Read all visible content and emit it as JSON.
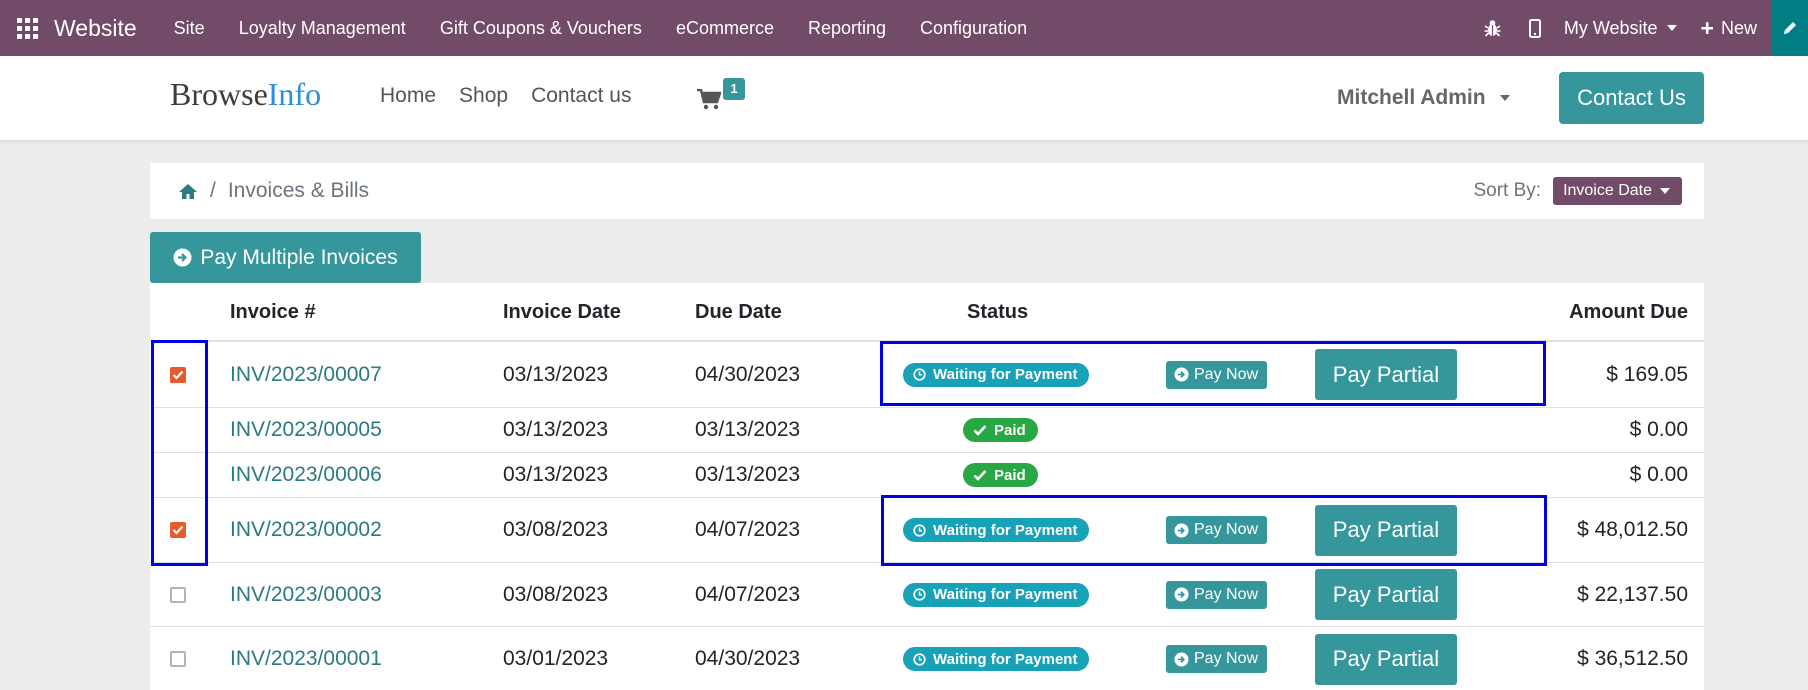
{
  "admin_bar": {
    "brand": "Website",
    "menu": [
      "Site",
      "Loyalty Management",
      "Gift Coupons & Vouchers",
      "eCommerce",
      "Reporting",
      "Configuration"
    ],
    "website_selector": "My Website",
    "new_label": "New",
    "icons": [
      "apps-icon",
      "bug-icon",
      "mobile-icon",
      "pencil-icon"
    ]
  },
  "header": {
    "logo_part1": "Browse",
    "logo_part2": "Info",
    "nav": [
      "Home",
      "Shop",
      "Contact us"
    ],
    "cart_count": "1",
    "user_name": "Mitchell Admin",
    "contact_button": "Contact Us"
  },
  "breadcrumb": {
    "separator": "/",
    "current": "Invoices & Bills"
  },
  "sort": {
    "label": "Sort By:",
    "value": "Invoice Date"
  },
  "pay_multiple_label": "Pay Multiple Invoices",
  "table": {
    "columns": [
      "Invoice #",
      "Invoice Date",
      "Due Date",
      "Status",
      "Amount Due"
    ],
    "rows": [
      {
        "number": "INV/2023/00007",
        "invoice_date": "03/13/2023",
        "due_date": "04/30/2023",
        "status": "Waiting for Payment",
        "pay_now": "Pay Now",
        "pay_partial": "Pay Partial",
        "amount": "$ 169.05",
        "checked": true
      },
      {
        "number": "INV/2023/00005",
        "invoice_date": "03/13/2023",
        "due_date": "03/13/2023",
        "status": "Paid",
        "amount": "$ 0.00"
      },
      {
        "number": "INV/2023/00006",
        "invoice_date": "03/13/2023",
        "due_date": "03/13/2023",
        "status": "Paid",
        "amount": "$ 0.00"
      },
      {
        "number": "INV/2023/00002",
        "invoice_date": "03/08/2023",
        "due_date": "04/07/2023",
        "status": "Waiting for Payment",
        "pay_now": "Pay Now",
        "pay_partial": "Pay Partial",
        "amount": "$ 48,012.50",
        "checked": true
      },
      {
        "number": "INV/2023/00003",
        "invoice_date": "03/08/2023",
        "due_date": "04/07/2023",
        "status": "Waiting for Payment",
        "pay_now": "Pay Now",
        "pay_partial": "Pay Partial",
        "amount": "$ 22,137.50",
        "checked": false
      },
      {
        "number": "INV/2023/00001",
        "invoice_date": "03/01/2023",
        "due_date": "04/30/2023",
        "status": "Waiting for Payment",
        "pay_now": "Pay Now",
        "pay_partial": "Pay Partial",
        "amount": "$ 36,512.50",
        "checked": false
      }
    ]
  },
  "colors": {
    "admin_bar": "#714b67",
    "primary": "#35979c",
    "link": "#2b7a7f",
    "badge_waiting": "#17a2b8",
    "badge_paid": "#28a745",
    "checkbox_checked": "#e85a2e",
    "highlight_box": "#0000e6"
  }
}
